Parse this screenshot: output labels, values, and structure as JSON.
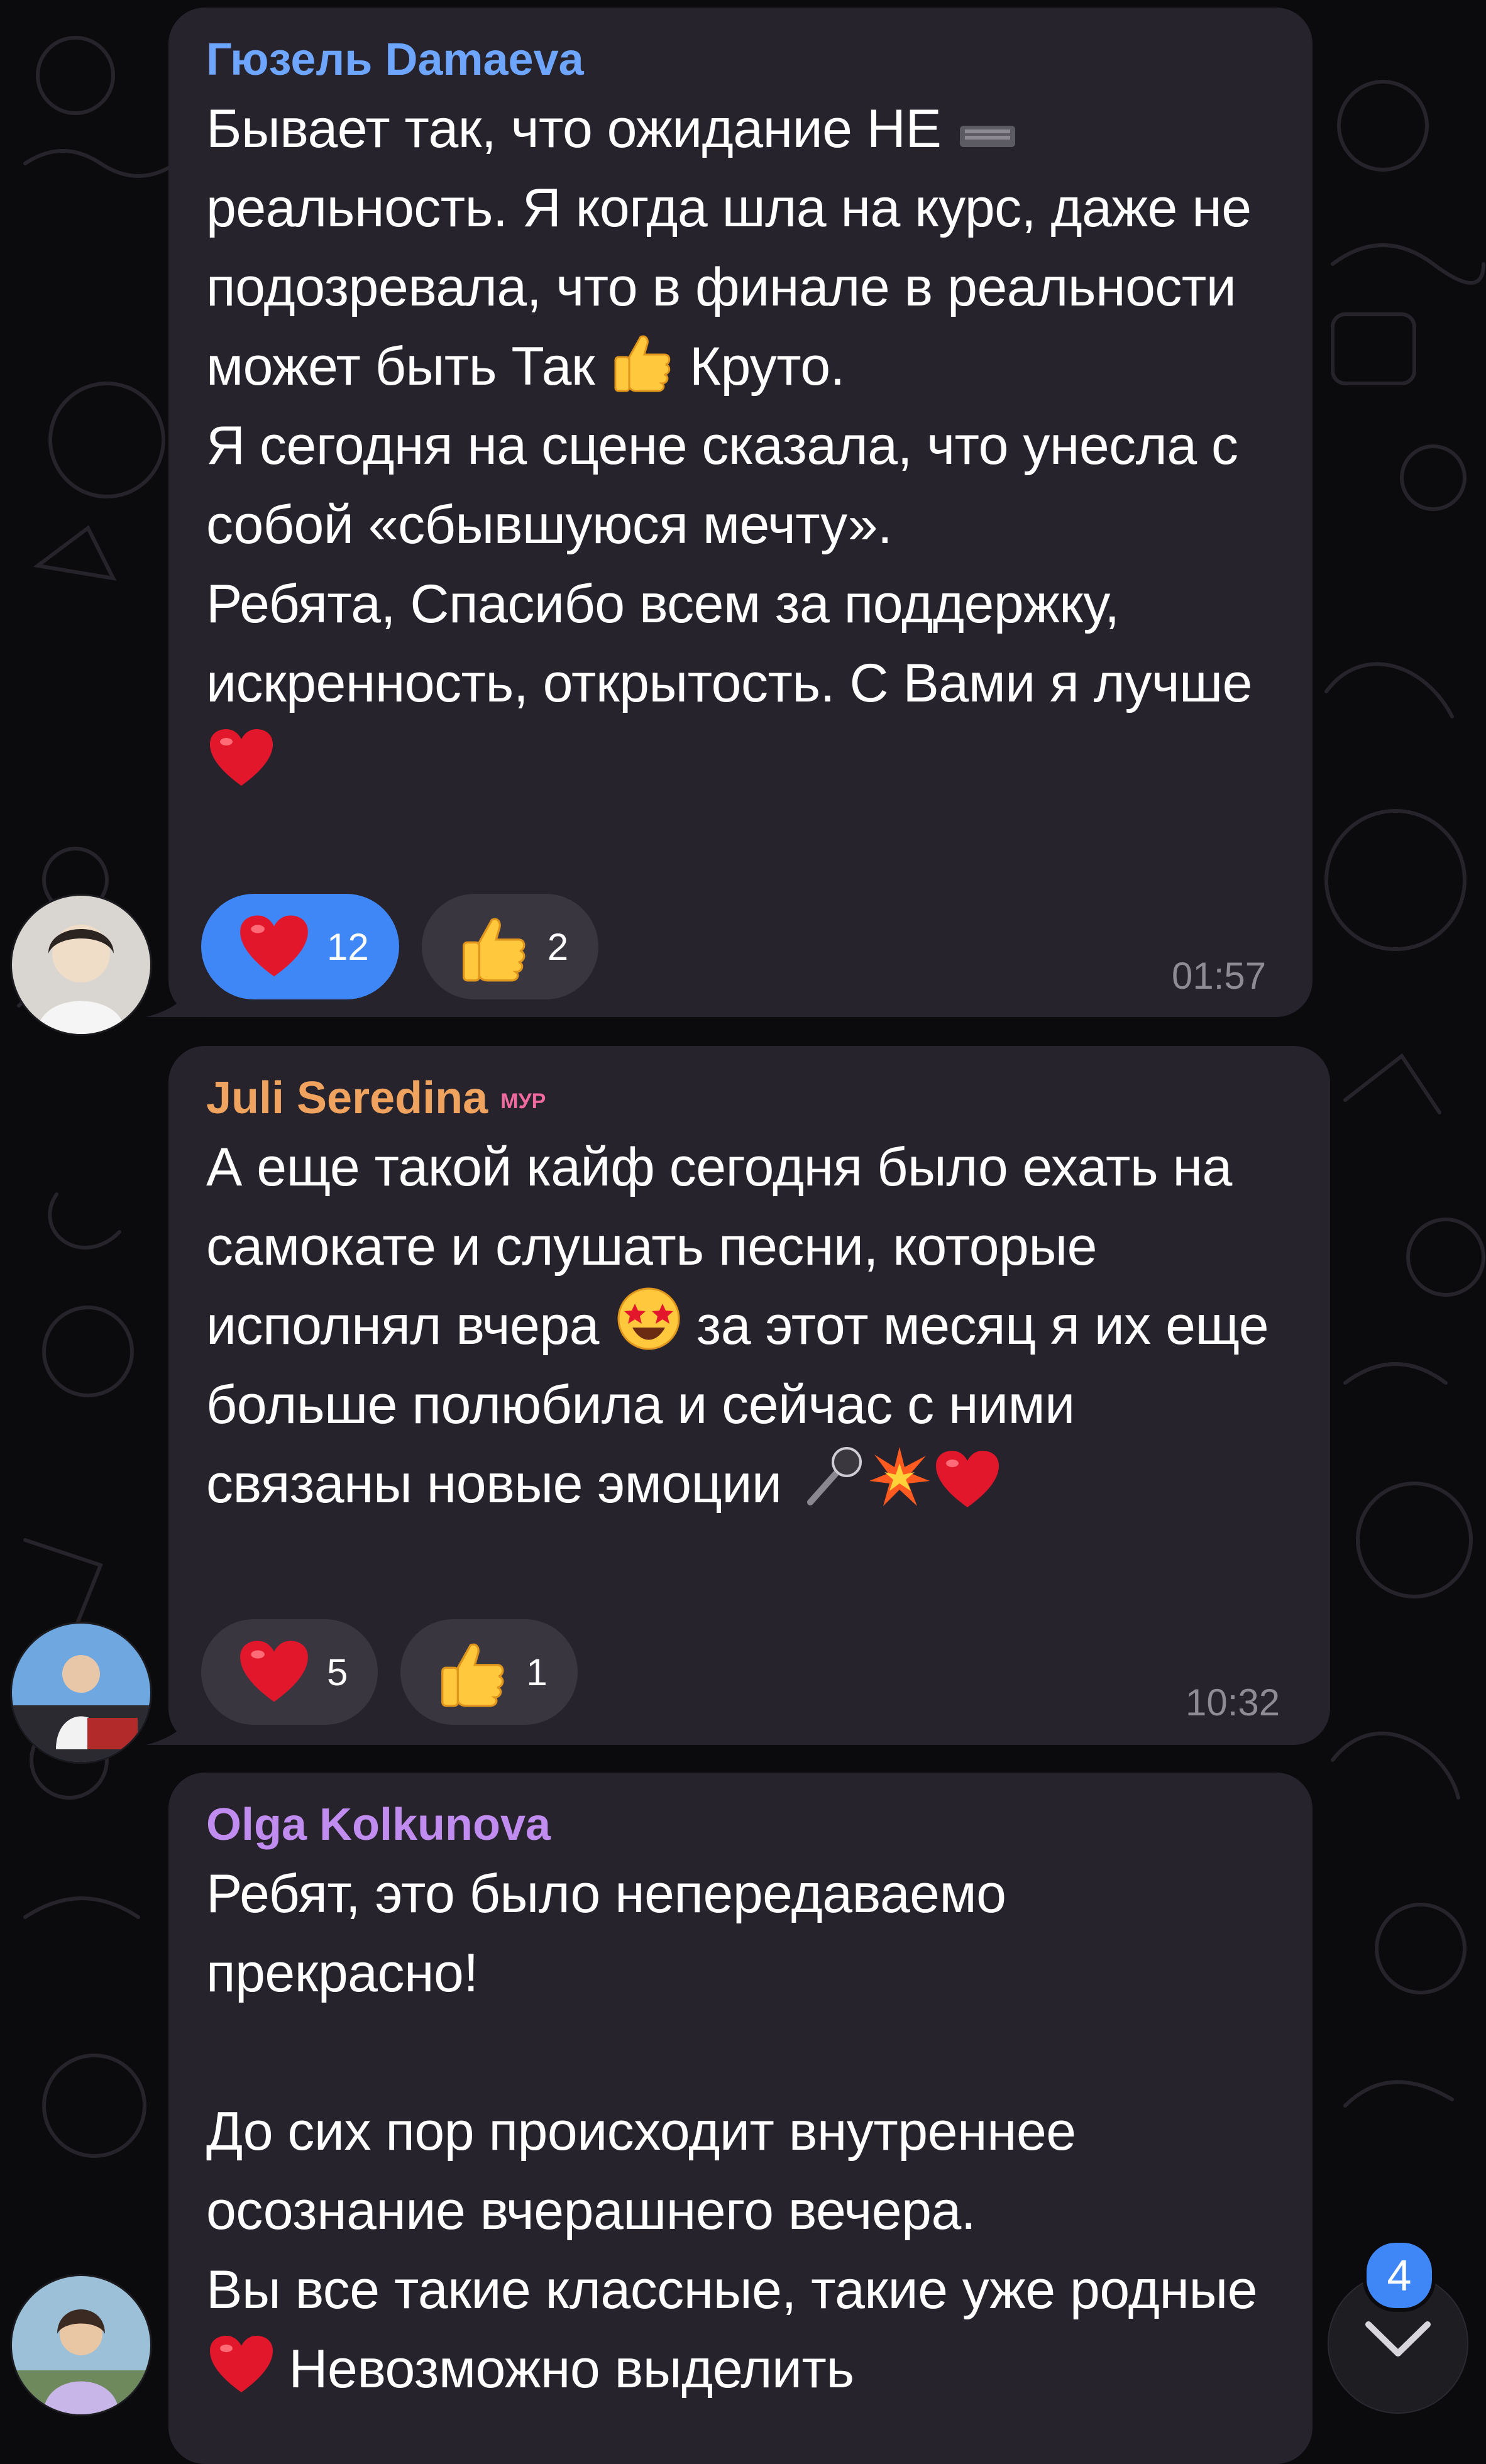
{
  "colors": {
    "background": "#0b0b0d",
    "bubble": "#26232c",
    "reaction": "#3a3640",
    "reaction_active": "#3f86f7",
    "timestamp": "#8f8b96"
  },
  "messages": [
    {
      "sender": "Гюзель Damaeva",
      "sender_color": "#6ea6ff",
      "text_parts": [
        "Бывает так, что ожидание НЕ ",
        " реальность. Я когда шла на курс, даже не подозревала, что в финале в реальности может быть Так ",
        " Круто.\nЯ сегодня на сцене сказала, что унесла с собой «сбывшуюся мечту».\nРебята, Спасибо всем за поддержку, искренность, открытость. С Вами я лучше "
      ],
      "reactions": [
        {
          "icon": "heart-icon",
          "count": "12",
          "active": true
        },
        {
          "icon": "thumbs-up-icon",
          "count": "2",
          "active": false
        }
      ],
      "time": "01:57"
    },
    {
      "sender": "Juli Seredina",
      "sender_color": "#f0a35e",
      "sender_badge": "МУР",
      "text_parts": [
        "А еще такой кайф сегодня было ехать на самокате и слушать песни, которые исполнял вчера ",
        " за этот месяц я их еще больше полюбила и сейчас с ними связаны новые эмоции "
      ],
      "reactions": [
        {
          "icon": "heart-icon",
          "count": "5",
          "active": false
        },
        {
          "icon": "thumbs-up-icon",
          "count": "1",
          "active": false
        }
      ],
      "time": "10:32"
    },
    {
      "sender": "Olga Kolkunova",
      "sender_color": "#c08cf0",
      "text_parts": [
        "Ребят, это было непередаваемо прекрасно!\n\nДо сих пор происходит внутреннее осознание вчерашнего вечера.\nВы все такие классные, такие уже родные ",
        " Невозможно выделить"
      ]
    }
  ],
  "scroll_button": {
    "unread_count": "4",
    "icon": "chevron-down-icon"
  }
}
